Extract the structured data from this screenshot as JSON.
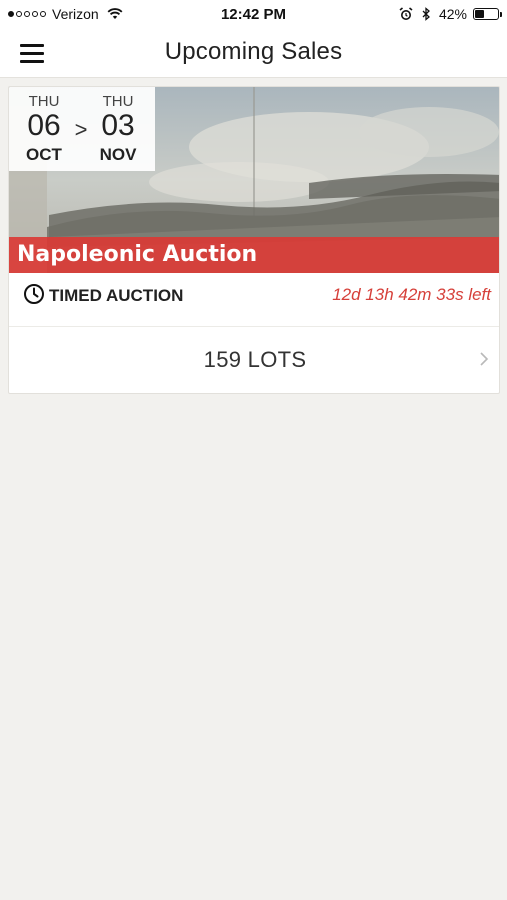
{
  "status_bar": {
    "signal_filled": 1,
    "signal_total": 5,
    "carrier": "Verizon",
    "time": "12:42 PM",
    "battery_percent_label": "42%",
    "battery_level": 0.42
  },
  "nav": {
    "title": "Upcoming Sales",
    "menu_icon": "hamburger-menu-icon"
  },
  "sale": {
    "start": {
      "day_name": "THU",
      "day": "06",
      "month": "OCT"
    },
    "separator": ">",
    "end": {
      "day_name": "THU",
      "day": "03",
      "month": "NOV"
    },
    "title": "Napoleonic Auction",
    "type_label": "TIMED AUCTION",
    "time_left": "12d 13h 42m 33s left",
    "lots_label": "159 LOTS"
  },
  "colors": {
    "accent": "#dc3834",
    "background": "#f2f1ee"
  }
}
